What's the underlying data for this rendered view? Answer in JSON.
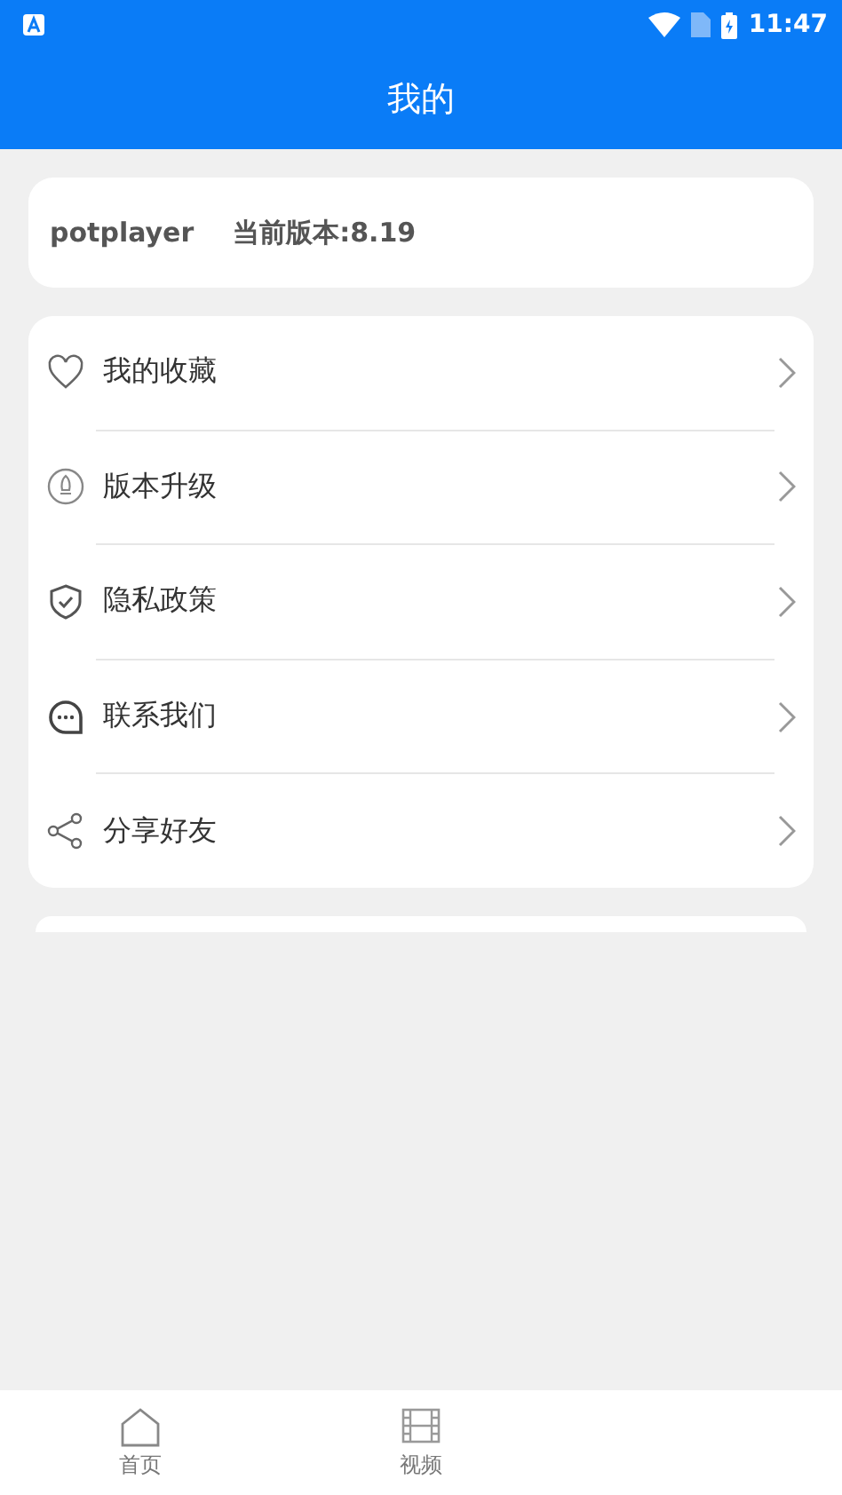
{
  "status_bar": {
    "time": "11:47"
  },
  "header": {
    "title": "我的"
  },
  "info_card": {
    "app_name": "potplayer",
    "version": "当前版本:8.19"
  },
  "menu": [
    {
      "label": "我的收藏"
    },
    {
      "label": "版本升级"
    },
    {
      "label": "隐私政策"
    },
    {
      "label": "联系我们"
    },
    {
      "label": "分享好友"
    }
  ],
  "bottom_nav": [
    {
      "label": "首页"
    },
    {
      "label": "视频"
    }
  ]
}
